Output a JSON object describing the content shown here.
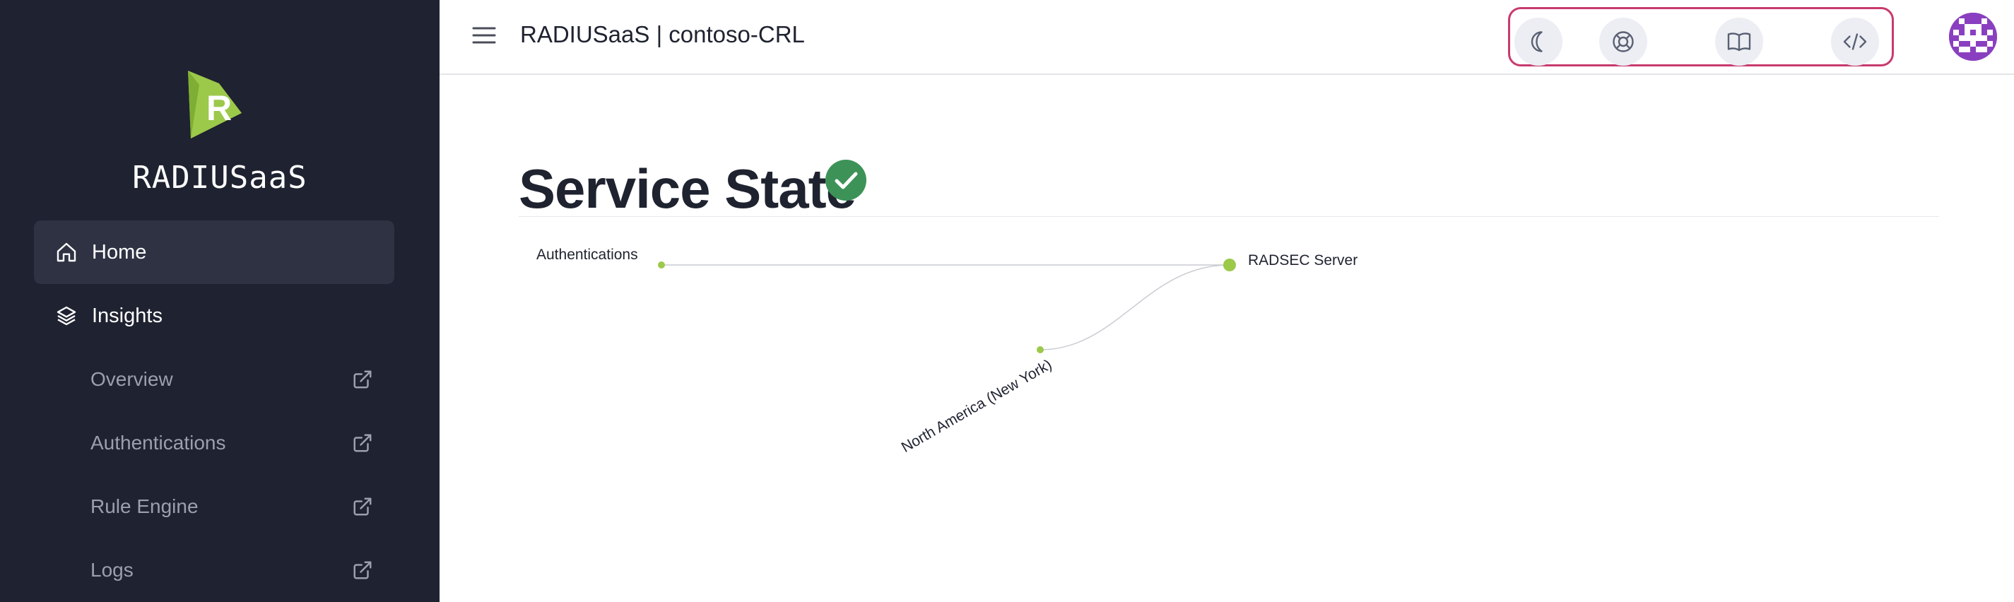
{
  "sidebar": {
    "brand": "RADIUSaaS",
    "logo_letter": "R",
    "items": [
      {
        "label": "Home",
        "icon": "home-icon",
        "active": true
      },
      {
        "label": "Insights",
        "icon": "layers-icon",
        "active": false
      }
    ],
    "subitems": [
      {
        "label": "Overview",
        "icon": "external-link-icon"
      },
      {
        "label": "Authentications",
        "icon": "external-link-icon"
      },
      {
        "label": "Rule Engine",
        "icon": "external-link-icon"
      },
      {
        "label": "Logs",
        "icon": "external-link-icon"
      }
    ]
  },
  "header": {
    "title": "RADIUSaaS | contoso-CRL",
    "toolbar": [
      {
        "icon": "moon-icon"
      },
      {
        "icon": "lifebuoy-icon"
      },
      {
        "icon": "book-icon"
      },
      {
        "icon": "code-icon"
      }
    ],
    "accent": "#c83a6e"
  },
  "main": {
    "title": "Service State",
    "status": "ok",
    "status_color": "#3d9258",
    "graph": {
      "node_color": "#9cc94a",
      "nodes": [
        "Authentications",
        "RADSEC Server",
        "North America (New York)"
      ]
    }
  }
}
